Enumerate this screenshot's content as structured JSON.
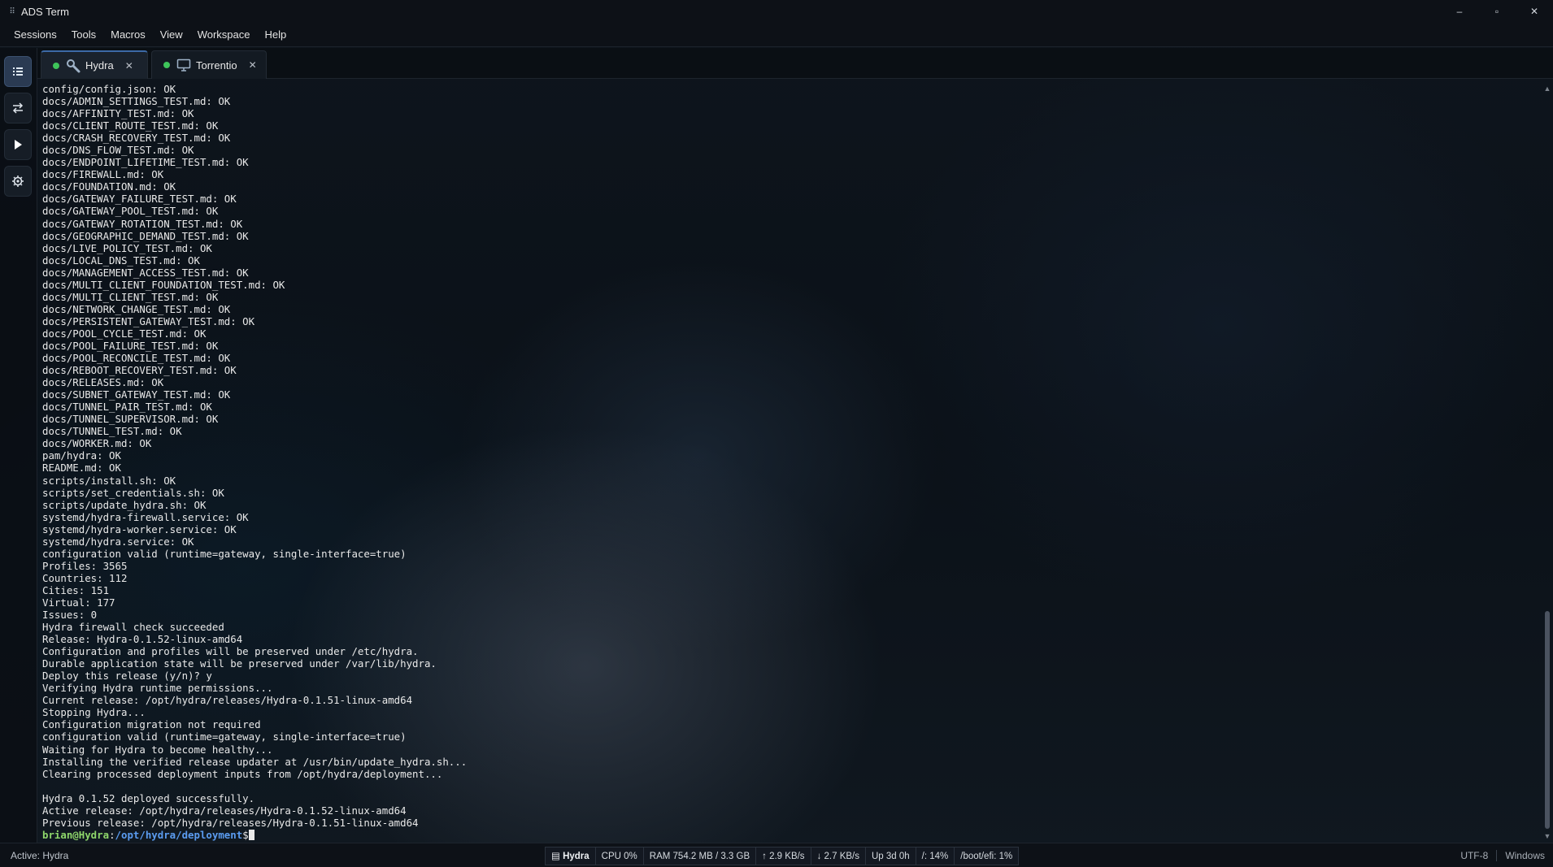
{
  "window": {
    "title": "ADS Term",
    "minimize": "–",
    "maximize": "▫",
    "close": "✕"
  },
  "menu": [
    "Sessions",
    "Tools",
    "Macros",
    "View",
    "Workspace",
    "Help"
  ],
  "sidebar": {
    "buttons": [
      {
        "name": "sessions-list",
        "icon": "list-icon"
      },
      {
        "name": "transfer",
        "icon": "swap-arrows-icon"
      },
      {
        "name": "run-macro",
        "icon": "play-icon"
      },
      {
        "name": "settings",
        "icon": "gear-icon"
      }
    ]
  },
  "tabs": [
    {
      "label": "Hydra",
      "icon": "wrench-icon",
      "status": "connected",
      "close": "✕",
      "active": true
    },
    {
      "label": "Torrentio",
      "icon": "monitor-icon",
      "status": "connected",
      "close": "✕",
      "active": false
    }
  ],
  "terminal": {
    "lines": [
      "config/config.json: OK",
      "docs/ADMIN_SETTINGS_TEST.md: OK",
      "docs/AFFINITY_TEST.md: OK",
      "docs/CLIENT_ROUTE_TEST.md: OK",
      "docs/CRASH_RECOVERY_TEST.md: OK",
      "docs/DNS_FLOW_TEST.md: OK",
      "docs/ENDPOINT_LIFETIME_TEST.md: OK",
      "docs/FIREWALL.md: OK",
      "docs/FOUNDATION.md: OK",
      "docs/GATEWAY_FAILURE_TEST.md: OK",
      "docs/GATEWAY_POOL_TEST.md: OK",
      "docs/GATEWAY_ROTATION_TEST.md: OK",
      "docs/GEOGRAPHIC_DEMAND_TEST.md: OK",
      "docs/LIVE_POLICY_TEST.md: OK",
      "docs/LOCAL_DNS_TEST.md: OK",
      "docs/MANAGEMENT_ACCESS_TEST.md: OK",
      "docs/MULTI_CLIENT_FOUNDATION_TEST.md: OK",
      "docs/MULTI_CLIENT_TEST.md: OK",
      "docs/NETWORK_CHANGE_TEST.md: OK",
      "docs/PERSISTENT_GATEWAY_TEST.md: OK",
      "docs/POOL_CYCLE_TEST.md: OK",
      "docs/POOL_FAILURE_TEST.md: OK",
      "docs/POOL_RECONCILE_TEST.md: OK",
      "docs/REBOOT_RECOVERY_TEST.md: OK",
      "docs/RELEASES.md: OK",
      "docs/SUBNET_GATEWAY_TEST.md: OK",
      "docs/TUNNEL_PAIR_TEST.md: OK",
      "docs/TUNNEL_SUPERVISOR.md: OK",
      "docs/TUNNEL_TEST.md: OK",
      "docs/WORKER.md: OK",
      "pam/hydra: OK",
      "README.md: OK",
      "scripts/install.sh: OK",
      "scripts/set_credentials.sh: OK",
      "scripts/update_hydra.sh: OK",
      "systemd/hydra-firewall.service: OK",
      "systemd/hydra-worker.service: OK",
      "systemd/hydra.service: OK",
      "configuration valid (runtime=gateway, single-interface=true)",
      "Profiles: 3565",
      "Countries: 112",
      "Cities: 151",
      "Virtual: 177",
      "Issues: 0",
      "Hydra firewall check succeeded",
      "Release: Hydra-0.1.52-linux-amd64",
      "Configuration and profiles will be preserved under /etc/hydra.",
      "Durable application state will be preserved under /var/lib/hydra.",
      "Deploy this release (y/n)? y",
      "Verifying Hydra runtime permissions...",
      "Current release: /opt/hydra/releases/Hydra-0.1.51-linux-amd64",
      "Stopping Hydra...",
      "Configuration migration not required",
      "configuration valid (runtime=gateway, single-interface=true)",
      "Waiting for Hydra to become healthy...",
      "Installing the verified release updater at /usr/bin/update_hydra.sh...",
      "Clearing processed deployment inputs from /opt/hydra/deployment...",
      "",
      "Hydra 0.1.52 deployed successfully.",
      "Active release: /opt/hydra/releases/Hydra-0.1.52-linux-amd64",
      "Previous release: /opt/hydra/releases/Hydra-0.1.51-linux-amd64"
    ],
    "prompt": {
      "user_host": "brian@Hydra",
      "separator": ":",
      "path": "/opt/hydra/deployment",
      "symbol": "$"
    }
  },
  "scrollbar": {
    "up": "▲",
    "down": "▼"
  },
  "statusbar": {
    "active": "Active: Hydra",
    "session": "Hydra",
    "cpu": "CPU 0%",
    "ram": "RAM 754.2 MB / 3.3 GB",
    "upload": "↑ 2.9 KB/s",
    "download": "↓ 2.7 KB/s",
    "uptime": "Up 3d 0h",
    "disk_root": "/: 14%",
    "disk_boot": "/boot/efi: 1%",
    "encoding": "UTF-8",
    "platform": "Windows"
  },
  "colors": {
    "prompt_user": "#8ed66b",
    "prompt_path": "#5b9cf0",
    "status_dot": "#3ec45a",
    "active_tab_accent": "#3c6aa6"
  }
}
